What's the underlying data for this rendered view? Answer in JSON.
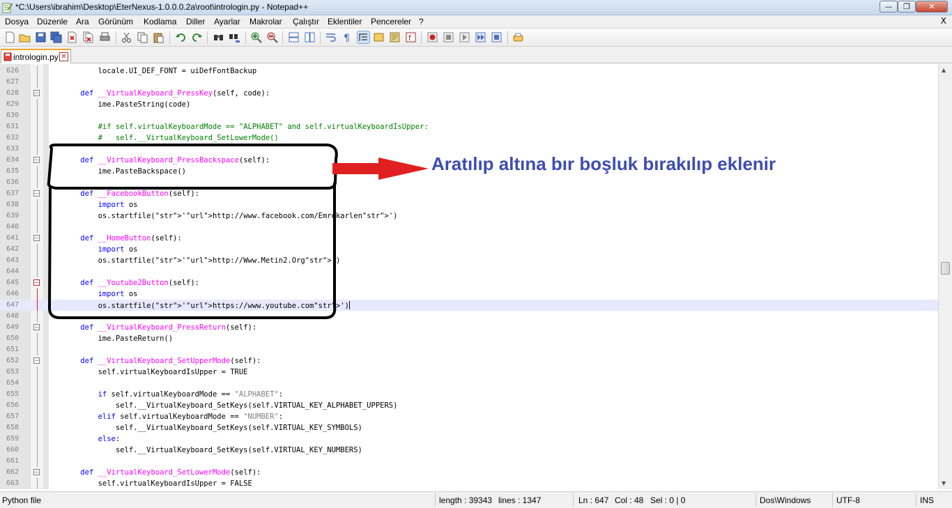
{
  "window": {
    "title": "*C:\\Users\\ibrahim\\Desktop\\EterNexus-1.0.0.0.2a\\root\\intrologin.py - Notepad++",
    "min_glyph": "—",
    "max_glyph": "❐",
    "close_glyph": "✕"
  },
  "menu": [
    "Dosya",
    "Düzenle",
    "Ara",
    "Görünüm",
    "Kodlama",
    "Diller",
    "Ayarlar",
    "Makrolar",
    "Çalıştır",
    "Eklentiler",
    "Pencereler",
    "?"
  ],
  "menu_close": "X",
  "toolbar": [
    "new-file-icon",
    "open-file-icon",
    "save-icon",
    "save-all-icon",
    "close-icon",
    "close-all-icon",
    "print-icon",
    "cut-icon",
    "copy-icon",
    "paste-icon",
    "undo-icon",
    "redo-icon",
    "find-icon",
    "replace-icon",
    "zoom-in-icon",
    "zoom-out-icon",
    "sync-vertical-icon",
    "sync-horizontal-icon",
    "word-wrap-icon",
    "show-all-chars-icon",
    "indent-guide-icon",
    "user-language-icon",
    "doc-map-icon",
    "function-list-icon",
    "record-macro-icon",
    "stop-macro-icon",
    "play-macro-icon",
    "run-macro-multiple-icon",
    "save-macro-icon",
    "spellcheck-icon"
  ],
  "tab": {
    "label": "intrologin.py",
    "close_glyph": "✕"
  },
  "editor": {
    "current_line": 647,
    "lines": [
      {
        "n": "626",
        "code": "        locale.UI_DEF_FONT = uiDefFontBackup"
      },
      {
        "n": "627",
        "code": ""
      },
      {
        "n": "628",
        "code": "    def __VirtualKeyboard_PressKey(self, code):"
      },
      {
        "n": "629",
        "code": "        ime.PasteString(code)"
      },
      {
        "n": "630",
        "code": ""
      },
      {
        "n": "631",
        "code": "        #if self.virtualKeyboardMode == \"ALPHABET\" and self.virtualKeyboardIsUpper:"
      },
      {
        "n": "632",
        "code": "        #   self.__VirtualKeyboard_SetLowerMode()"
      },
      {
        "n": "633",
        "code": ""
      },
      {
        "n": "634",
        "code": "    def __VirtualKeyboard_PressBackspace(self):"
      },
      {
        "n": "635",
        "code": "        ime.PasteBackspace()"
      },
      {
        "n": "636",
        "code": ""
      },
      {
        "n": "637",
        "code": "    def __FacebookButton(self):"
      },
      {
        "n": "638",
        "code": "        import os"
      },
      {
        "n": "639",
        "code": "        os.startfile('http://www.facebook.com/Emrekarlen')"
      },
      {
        "n": "640",
        "code": ""
      },
      {
        "n": "641",
        "code": "    def __HomeButton(self):"
      },
      {
        "n": "642",
        "code": "        import os"
      },
      {
        "n": "643",
        "code": "        os.startfile('http://Www.Metin2.Org')"
      },
      {
        "n": "644",
        "code": ""
      },
      {
        "n": "645",
        "code": "    def __Youtube2Button(self):"
      },
      {
        "n": "646",
        "code": "        import os"
      },
      {
        "n": "647",
        "code": "        os.startfile('https://www.youtube.com')"
      },
      {
        "n": "648",
        "code": ""
      },
      {
        "n": "649",
        "code": "    def __VirtualKeyboard_PressReturn(self):"
      },
      {
        "n": "650",
        "code": "        ime.PasteReturn()"
      },
      {
        "n": "651",
        "code": ""
      },
      {
        "n": "652",
        "code": "    def __VirtualKeyboard_SetUpperMode(self):"
      },
      {
        "n": "653",
        "code": "        self.virtualKeyboardIsUpper = TRUE"
      },
      {
        "n": "654",
        "code": ""
      },
      {
        "n": "655",
        "code": "        if self.virtualKeyboardMode == \"ALPHABET\":"
      },
      {
        "n": "656",
        "code": "            self.__VirtualKeyboard_SetKeys(self.VIRTUAL_KEY_ALPHABET_UPPERS)"
      },
      {
        "n": "657",
        "code": "        elif self.virtualKeyboardMode == \"NUMBER\":"
      },
      {
        "n": "658",
        "code": "            self.__VirtualKeyboard_SetKeys(self.VIRTUAL_KEY_SYMBOLS)"
      },
      {
        "n": "659",
        "code": "        else:"
      },
      {
        "n": "660",
        "code": "            self.__VirtualKeyboard_SetKeys(self.VIRTUAL_KEY_NUMBERS)"
      },
      {
        "n": "661",
        "code": ""
      },
      {
        "n": "662",
        "code": "    def __VirtualKeyboard_SetLowerMode(self):"
      },
      {
        "n": "663",
        "code": "        self.virtualKeyboardIsUpper = FALSE"
      }
    ]
  },
  "annotation": {
    "text": "Aratılıp altına bır boşluk bırakılıp eklenir",
    "text_color": "#3d4db0",
    "arrow_color": "#e02020",
    "box_color": "#000000"
  },
  "status": {
    "file_type": "Python file",
    "length": "length : 39343",
    "lines": "lines : 1347",
    "ln": "Ln : 647",
    "col": "Col : 48",
    "sel": "Sel : 0 | 0",
    "eol": "Dos\\Windows",
    "encoding": "UTF-8",
    "mode": "INS"
  }
}
